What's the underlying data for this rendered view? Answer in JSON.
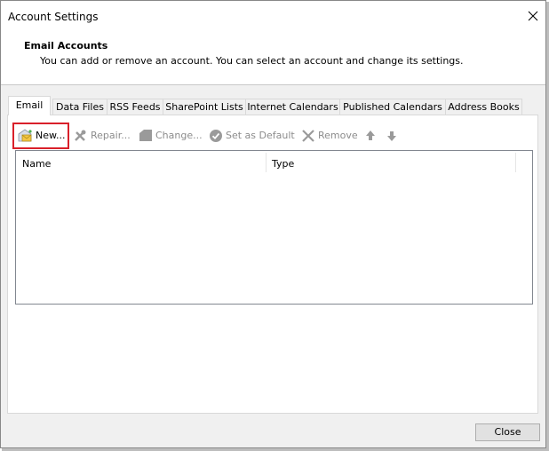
{
  "window": {
    "title": "Account Settings",
    "close_icon": "close-icon"
  },
  "header": {
    "title": "Email Accounts",
    "description": "You can add or remove an account. You can select an account and change its settings."
  },
  "tabs": [
    {
      "label": "Email",
      "active": true
    },
    {
      "label": "Data Files",
      "active": false
    },
    {
      "label": "RSS Feeds",
      "active": false
    },
    {
      "label": "SharePoint Lists",
      "active": false
    },
    {
      "label": "Internet Calendars",
      "active": false
    },
    {
      "label": "Published Calendars",
      "active": false
    },
    {
      "label": "Address Books",
      "active": false
    }
  ],
  "toolbar": {
    "new_label": "New...",
    "repair_label": "Repair...",
    "change_label": "Change...",
    "set_default_label": "Set as Default",
    "remove_label": "Remove",
    "highlight_color": "#d9202a"
  },
  "list": {
    "columns": [
      "Name",
      "Type"
    ],
    "rows": []
  },
  "footer": {
    "close_label": "Close"
  }
}
